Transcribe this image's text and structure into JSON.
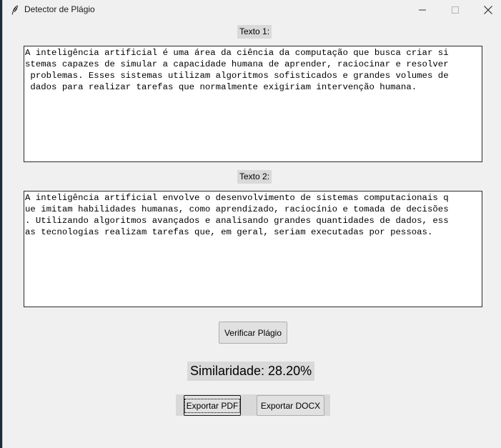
{
  "window": {
    "title": "Detector de Plágio",
    "controls": {
      "minimize": "minimize-icon",
      "maximize": "maximize-icon",
      "close": "close-icon"
    }
  },
  "text1": {
    "label": "Texto 1:",
    "content": "A inteligência artificial é uma área da ciência da computação que busca criar si\nstemas capazes de simular a capacidade humana de aprender, raciocinar e resolver\n problemas. Esses sistemas utilizam algoritmos sofisticados e grandes volumes de\n dados para realizar tarefas que normalmente exigiriam intervenção humana."
  },
  "text2": {
    "label": "Texto 2:",
    "content": "A inteligência artificial envolve o desenvolvimento de sistemas computacionais q\nue imitam habilidades humanas, como aprendizado, raciocínio e tomada de decisões\n. Utilizando algoritmos avançados e analisando grandes quantidades de dados, ess\nas tecnologias realizam tarefas que, em geral, seriam executadas por pessoas."
  },
  "actions": {
    "verify_label": "Verificar Plágio",
    "export_pdf_label": "Exportar PDF",
    "export_docx_label": "Exportar DOCX"
  },
  "result": {
    "similarity_text": "Similaridade: 28.20%"
  },
  "colors": {
    "window_bg": "#f0f0f0",
    "label_bg": "#d9d9d9",
    "button_bg": "#e1e1e1"
  }
}
